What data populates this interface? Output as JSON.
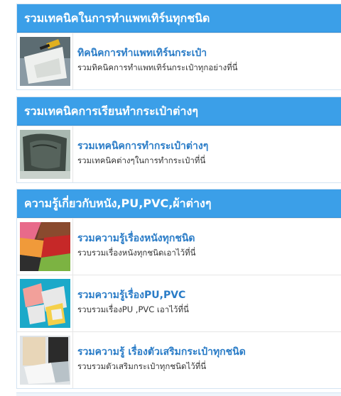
{
  "colors": {
    "header_bg": "#3b9fe8",
    "link": "#2a7cc7",
    "desc": "#333333"
  },
  "sections": [
    {
      "title": "รวมเทคนิคในการทำแพทเทิร์นทุกชนิด",
      "items": [
        {
          "title": "ทิคนิคการทำแพทเทิร์นกระเป๋า",
          "desc": "รวมทิคนิคการทำแพทเทิร์นกระเป๋าทุกอย่างที่นี่",
          "thumb": "pattern-cutting-photo"
        }
      ]
    },
    {
      "title": "รวมเทคนิคการเรียนทำกระเป๋าต่างๆ",
      "items": [
        {
          "title": "รวมเทคนิคการทำกระเป๋าต่างๆ",
          "desc": "รวมเทคนิคต่างๆในการทำกระเป๋าที่นี่",
          "thumb": "bag-making-photo"
        }
      ]
    },
    {
      "title": "ความรู้เกี่ยวกับหนัง,PU,PVC,ผ้าต่างๆ",
      "items": [
        {
          "title": "รวมความรู้เรื่องหนังทุกชนิด",
          "desc": "รวบรวมเรื่องหนังทุกชนิดเอาไว้ที่นี่",
          "thumb": "leather-samples-photo"
        },
        {
          "title": "รวมความรู้เรื่องPU,PVC",
          "desc": "รวบรวมเรื่องPU ,PVC เอาไว้ที่นี่",
          "thumb": "pu-pvc-photo"
        },
        {
          "title": "รวมความรู้ เรื่องตัวเสริมกระเป๋าทุกชนิด",
          "desc": "รวบรวมตัวเสริมกระเป๋าทุกชนิดไว้ที่นี่",
          "thumb": "bag-reinforcement-photo"
        }
      ]
    }
  ]
}
